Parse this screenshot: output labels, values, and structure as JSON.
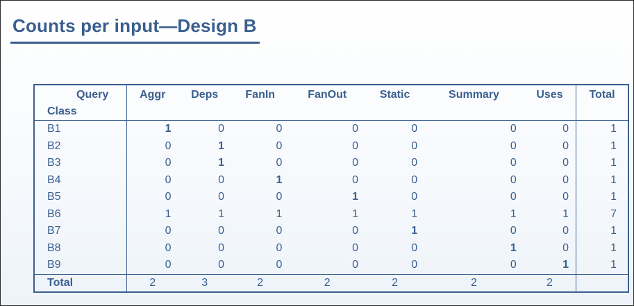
{
  "title": "Counts per input—Design B",
  "table": {
    "corner_line1": "Query",
    "corner_line2": "Class",
    "columns": [
      "Aggr",
      "Deps",
      "FanIn",
      "FanOut",
      "Static",
      "Summary",
      "Uses"
    ],
    "total_label": "Total",
    "rows": [
      {
        "cls": "B1",
        "vals": [
          "1",
          "0",
          "0",
          "0",
          "0",
          "0",
          "0"
        ],
        "total": "1"
      },
      {
        "cls": "B2",
        "vals": [
          "0",
          "1",
          "0",
          "0",
          "0",
          "0",
          "0"
        ],
        "total": "1"
      },
      {
        "cls": "B3",
        "vals": [
          "0",
          "1",
          "0",
          "0",
          "0",
          "0",
          "0"
        ],
        "total": "1"
      },
      {
        "cls": "B4",
        "vals": [
          "0",
          "0",
          "1",
          "0",
          "0",
          "0",
          "0"
        ],
        "total": "1"
      },
      {
        "cls": "B5",
        "vals": [
          "0",
          "0",
          "0",
          "1",
          "0",
          "0",
          "0"
        ],
        "total": "1"
      },
      {
        "cls": "B6",
        "vals": [
          "1",
          "1",
          "1",
          "1",
          "1",
          "1",
          "1"
        ],
        "total": "7"
      },
      {
        "cls": "B7",
        "vals": [
          "0",
          "0",
          "0",
          "0",
          "1",
          "0",
          "0"
        ],
        "total": "1"
      },
      {
        "cls": "B8",
        "vals": [
          "0",
          "0",
          "0",
          "0",
          "0",
          "1",
          "0"
        ],
        "total": "1"
      },
      {
        "cls": "B9",
        "vals": [
          "0",
          "0",
          "0",
          "0",
          "0",
          "0",
          "1"
        ],
        "total": "1"
      }
    ],
    "bold_cells": [
      [
        0,
        0
      ],
      [
        1,
        1
      ],
      [
        2,
        1
      ],
      [
        3,
        2
      ],
      [
        4,
        3
      ],
      [
        6,
        4
      ],
      [
        7,
        5
      ],
      [
        8,
        6
      ]
    ],
    "column_totals_label": "Total",
    "column_totals": [
      "2",
      "3",
      "2",
      "2",
      "2",
      "2",
      "2"
    ],
    "grand_total": ""
  },
  "colors": {
    "text": "#3a5f8e",
    "border": "#3a5f8e"
  }
}
